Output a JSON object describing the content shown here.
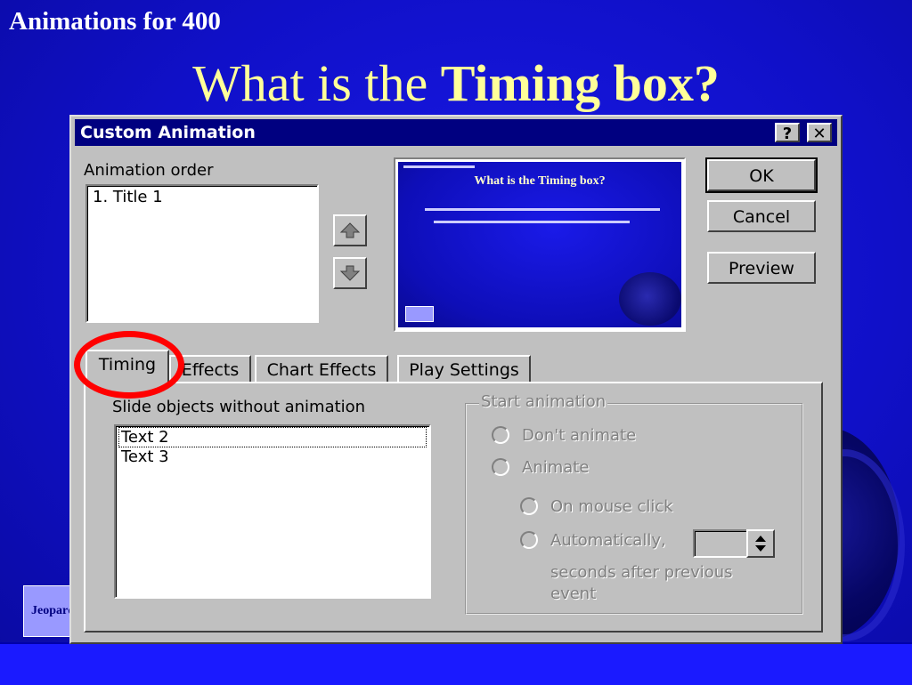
{
  "slide": {
    "category": "Animations for 400",
    "question_prefix": "What is the ",
    "question_bold": "Timing box?",
    "jeopardy_label": "Jeopardy"
  },
  "dialog": {
    "title": "Custom Animation",
    "help_glyph": "?",
    "close_glyph": "✕",
    "animation_order_label": "Animation order",
    "animation_order_items": [
      "1. Title 1"
    ],
    "buttons": {
      "ok": "OK",
      "cancel": "Cancel",
      "preview": "Preview"
    },
    "move_up_icon": "up-arrow-icon",
    "move_down_icon": "down-arrow-icon",
    "preview_slide": {
      "title": "What is the Timing box?"
    },
    "tabs": [
      "Timing",
      "Effects",
      "Chart Effects",
      "Play Settings"
    ],
    "active_tab": "Timing",
    "timing": {
      "slide_objects_label": "Slide objects without animation",
      "slide_objects": [
        "Text 2",
        "Text 3"
      ],
      "start_animation_label": "Start animation",
      "dont_animate": "Don't animate",
      "animate": "Animate",
      "on_mouse_click": "On mouse click",
      "automatically": "Automatically,",
      "seconds_after": "seconds after previous",
      "event": "event"
    }
  },
  "colors": {
    "slide_bg": "#1010c8",
    "question_text": "#ffff99",
    "titlebar": "#000080",
    "highlight_circle": "#ff0000"
  }
}
